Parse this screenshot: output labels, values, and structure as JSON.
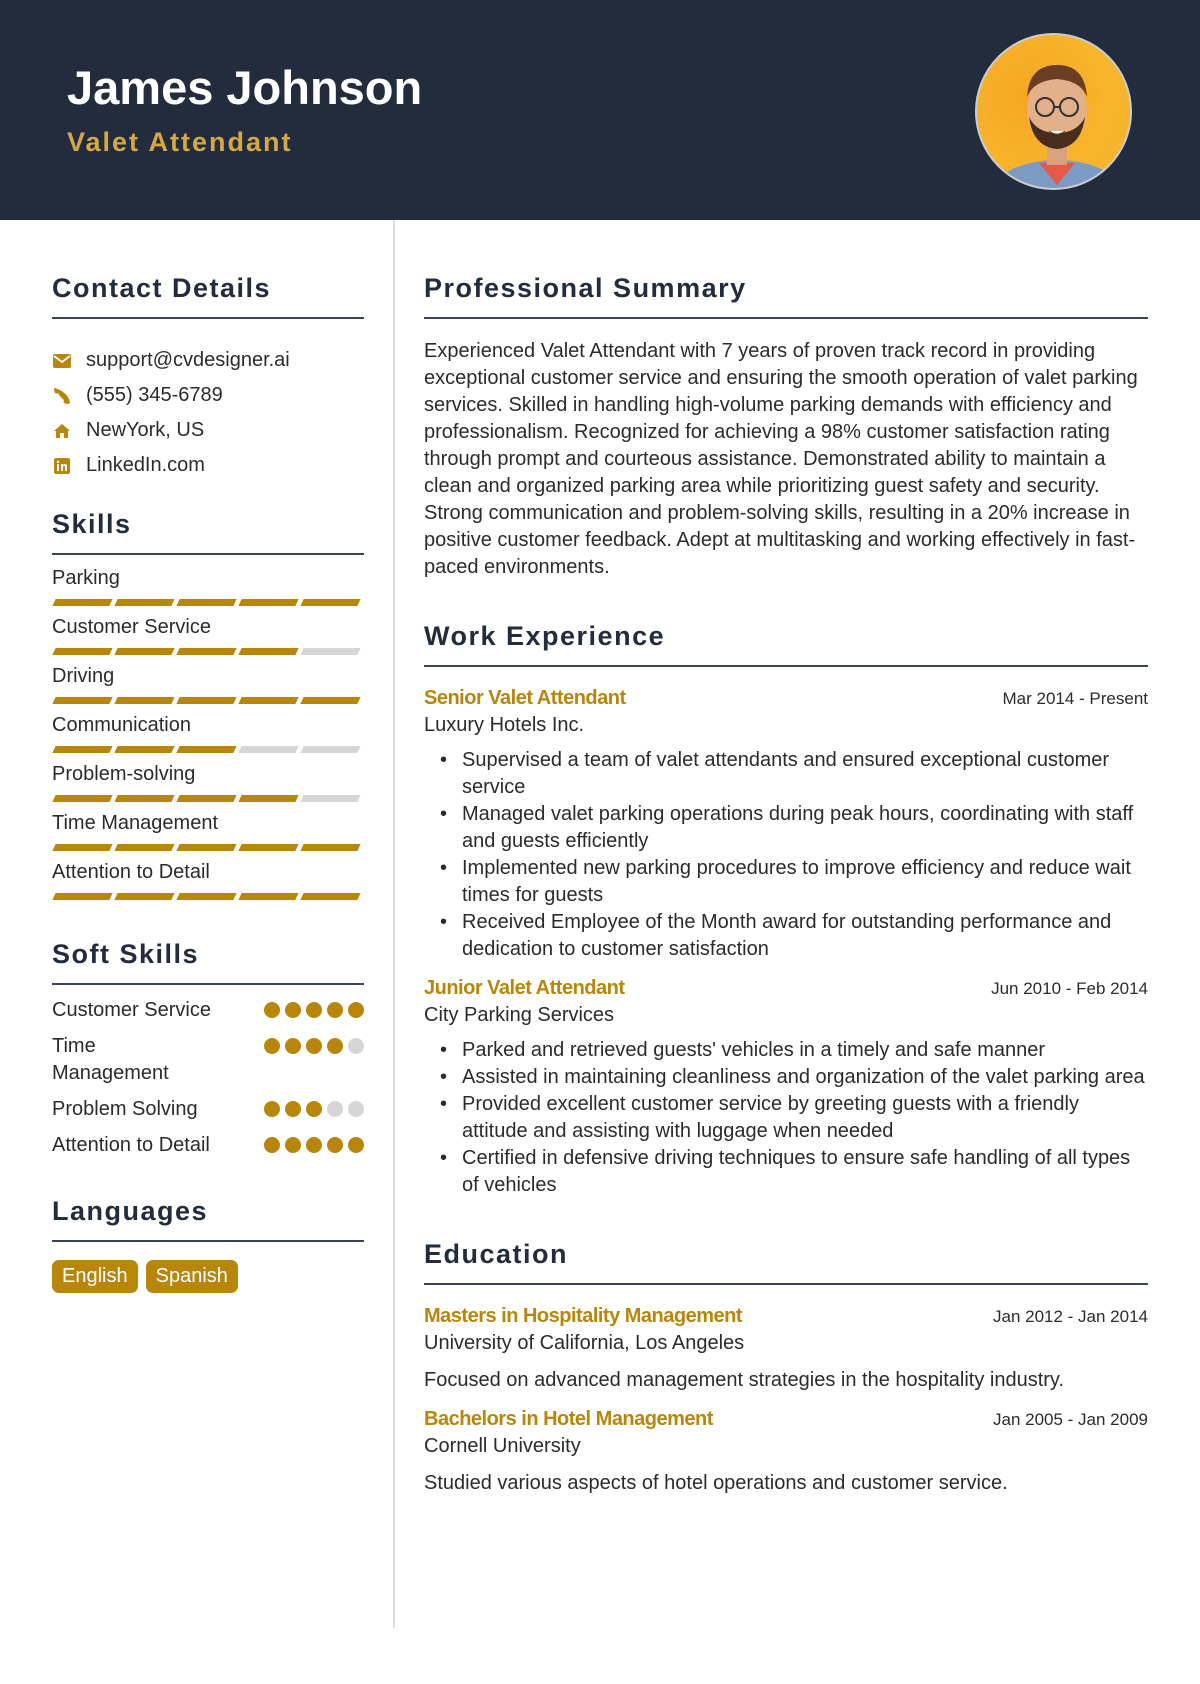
{
  "header": {
    "name": "James Johnson",
    "title": "Valet Attendant",
    "photo_alt": "profile-photo"
  },
  "colors": {
    "header_bg": "#232c3d",
    "accent": "#b8860b",
    "title_accent": "#d4a843",
    "inactive": "#d6d6d6"
  },
  "contact": {
    "heading": "Contact Details",
    "items": [
      {
        "icon": "envelope-icon",
        "text": "support@cvdesigner.ai"
      },
      {
        "icon": "phone-icon",
        "text": "(555) 345-6789"
      },
      {
        "icon": "home-icon",
        "text": "NewYork, US"
      },
      {
        "icon": "linkedin-icon",
        "text": "LinkedIn.com"
      }
    ]
  },
  "skills": {
    "heading": "Skills",
    "items": [
      {
        "name": "Parking",
        "level": 5,
        "max": 5
      },
      {
        "name": "Customer Service",
        "level": 4,
        "max": 5
      },
      {
        "name": "Driving",
        "level": 5,
        "max": 5
      },
      {
        "name": "Communication",
        "level": 3,
        "max": 5
      },
      {
        "name": "Problem-solving",
        "level": 4,
        "max": 5
      },
      {
        "name": "Time Management",
        "level": 5,
        "max": 5
      },
      {
        "name": "Attention to Detail",
        "level": 5,
        "max": 5
      }
    ]
  },
  "soft_skills": {
    "heading": "Soft Skills",
    "items": [
      {
        "name": "Customer Service",
        "level": 5,
        "max": 5
      },
      {
        "name": "Time Management",
        "level": 4,
        "max": 5
      },
      {
        "name": "Problem Solving",
        "level": 3,
        "max": 5
      },
      {
        "name": "Attention to Detail",
        "level": 5,
        "max": 5
      }
    ]
  },
  "languages": {
    "heading": "Languages",
    "items": [
      "English",
      "Spanish"
    ]
  },
  "summary": {
    "heading": "Professional Summary",
    "text": "Experienced Valet Attendant with 7 years of proven track record in providing exceptional customer service and ensuring the smooth operation of valet parking services. Skilled in handling high-volume parking demands with efficiency and professionalism. Recognized for achieving a 98% customer satisfaction rating through prompt and courteous assistance. Demonstrated ability to maintain a clean and organized parking area while prioritizing guest safety and security. Strong communication and problem-solving skills, resulting in a 20% increase in positive customer feedback. Adept at multitasking and working effectively in fast-paced environments."
  },
  "experience": {
    "heading": "Work Experience",
    "items": [
      {
        "title": "Senior Valet Attendant",
        "dates": "Mar 2014 - Present",
        "org": "Luxury Hotels Inc.",
        "bullets": [
          "Supervised a team of valet attendants and ensured exceptional customer service",
          "Managed valet parking operations during peak hours, coordinating with staff and guests efficiently",
          "Implemented new parking procedures to improve efficiency and reduce wait times for guests",
          "Received Employee of the Month award for outstanding performance and dedication to customer satisfaction"
        ]
      },
      {
        "title": "Junior Valet Attendant",
        "dates": "Jun 2010 - Feb 2014",
        "org": "City Parking Services",
        "bullets": [
          "Parked and retrieved guests' vehicles in a timely and safe manner",
          "Assisted in maintaining cleanliness and organization of the valet parking area",
          "Provided excellent customer service by greeting guests with a friendly attitude and assisting with luggage when needed",
          "Certified in defensive driving techniques to ensure safe handling of all types of vehicles"
        ]
      }
    ]
  },
  "education": {
    "heading": "Education",
    "items": [
      {
        "degree": "Masters in Hospitality Management",
        "dates": "Jan 2012 - Jan 2014",
        "school": "University of California, Los Angeles",
        "description": "Focused on advanced management strategies in the hospitality industry."
      },
      {
        "degree": "Bachelors in Hotel Management",
        "dates": "Jan 2005 - Jan 2009",
        "school": "Cornell University",
        "description": "Studied various aspects of hotel operations and customer service."
      }
    ]
  }
}
